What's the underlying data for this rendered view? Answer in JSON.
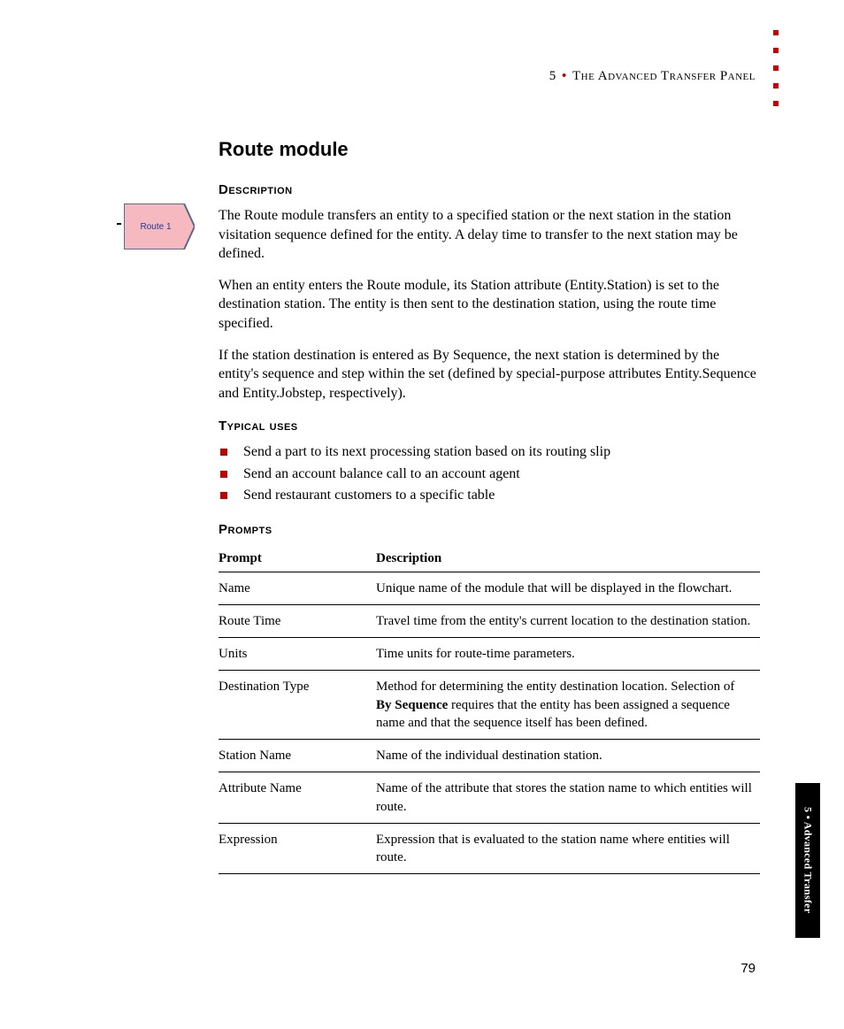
{
  "header": {
    "chapter_num": "5",
    "separator": "•",
    "chapter_title": "The Advanced Transfer Panel"
  },
  "module_icon_label": "Route 1",
  "title": "Route module",
  "sections": {
    "description": {
      "heading": "Description",
      "p1": "The Route module transfers an entity to a specified station or the next station in the station visitation sequence defined for the entity. A delay time to transfer to the next station may be defined.",
      "p2": "When an entity enters the Route module, its Station attribute (Entity.Station) is set to the destination station. The entity is then sent to the destination station, using the route time specified.",
      "p3": "If the station destination is entered as By Sequence, the next station is determined by the entity's sequence and step within the set (defined by special-purpose attributes Entity.Sequence and Entity.Jobstep, respectively)."
    },
    "typical_uses": {
      "heading": "Typical uses",
      "items": [
        "Send a part to its next processing station based on its routing slip",
        "Send an account balance call to an account agent",
        "Send restaurant customers to a specific table"
      ]
    },
    "prompts": {
      "heading": "Prompts",
      "columns": [
        "Prompt",
        "Description"
      ],
      "rows": [
        {
          "prompt": "Name",
          "desc": "Unique name of the module that will be displayed in the flowchart."
        },
        {
          "prompt": "Route Time",
          "desc": "Travel time from the entity's current location to the destination station."
        },
        {
          "prompt": "Units",
          "desc": "Time units for route-time parameters."
        },
        {
          "prompt": "Destination Type",
          "desc_pre": "Method for determining the entity destination location. Selection of ",
          "bold": "By Sequence",
          "desc_post": " requires that the entity has been assigned a sequence name and that the sequence itself has been defined."
        },
        {
          "prompt": "Station Name",
          "desc": "Name of the individual destination station."
        },
        {
          "prompt": "Attribute Name",
          "desc": "Name of the attribute that stores the station name to which entities will route."
        },
        {
          "prompt": "Expression",
          "desc": "Expression that is evaluated to the station name where entities will route."
        }
      ]
    }
  },
  "side_tab": "5 • Advanced Transfer",
  "page_number": "79"
}
